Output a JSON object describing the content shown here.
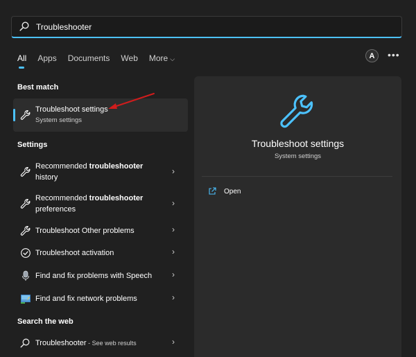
{
  "search": {
    "value": "Troubleshooter",
    "placeholder": ""
  },
  "tabs": [
    {
      "label": "All"
    },
    {
      "label": "Apps"
    },
    {
      "label": "Documents"
    },
    {
      "label": "Web"
    },
    {
      "label": "More"
    }
  ],
  "account": {
    "initial": "A"
  },
  "more_menu": "•••",
  "best_match": {
    "section_title": "Best match",
    "title": "Troubleshoot settings",
    "subtitle": "System settings"
  },
  "settings": {
    "section_title": "Settings",
    "items": [
      {
        "pre": "Recommended ",
        "bold": "troubleshooter",
        "line2": "history",
        "icon": "wrench-icon"
      },
      {
        "pre": "Recommended ",
        "bold": "troubleshooter",
        "line2": "preferences",
        "icon": "wrench-icon"
      },
      {
        "label": "Troubleshoot Other problems",
        "icon": "wrench-icon"
      },
      {
        "label": "Troubleshoot activation",
        "icon": "check-circle-icon"
      },
      {
        "label": "Find and fix problems with Speech",
        "icon": "microphone-icon"
      },
      {
        "label": "Find and fix network problems",
        "icon": "network-icon"
      }
    ]
  },
  "web": {
    "section_title": "Search the web",
    "query": "Troubleshooter",
    "suffix": " - See web results"
  },
  "detail": {
    "title": "Troubleshoot settings",
    "subtitle": "System settings",
    "action_open": "Open"
  },
  "colors": {
    "accent": "#4cc2ff",
    "background": "#202020",
    "panel": "#2b2b2b",
    "annotation_arrow": "#d01c1c"
  }
}
